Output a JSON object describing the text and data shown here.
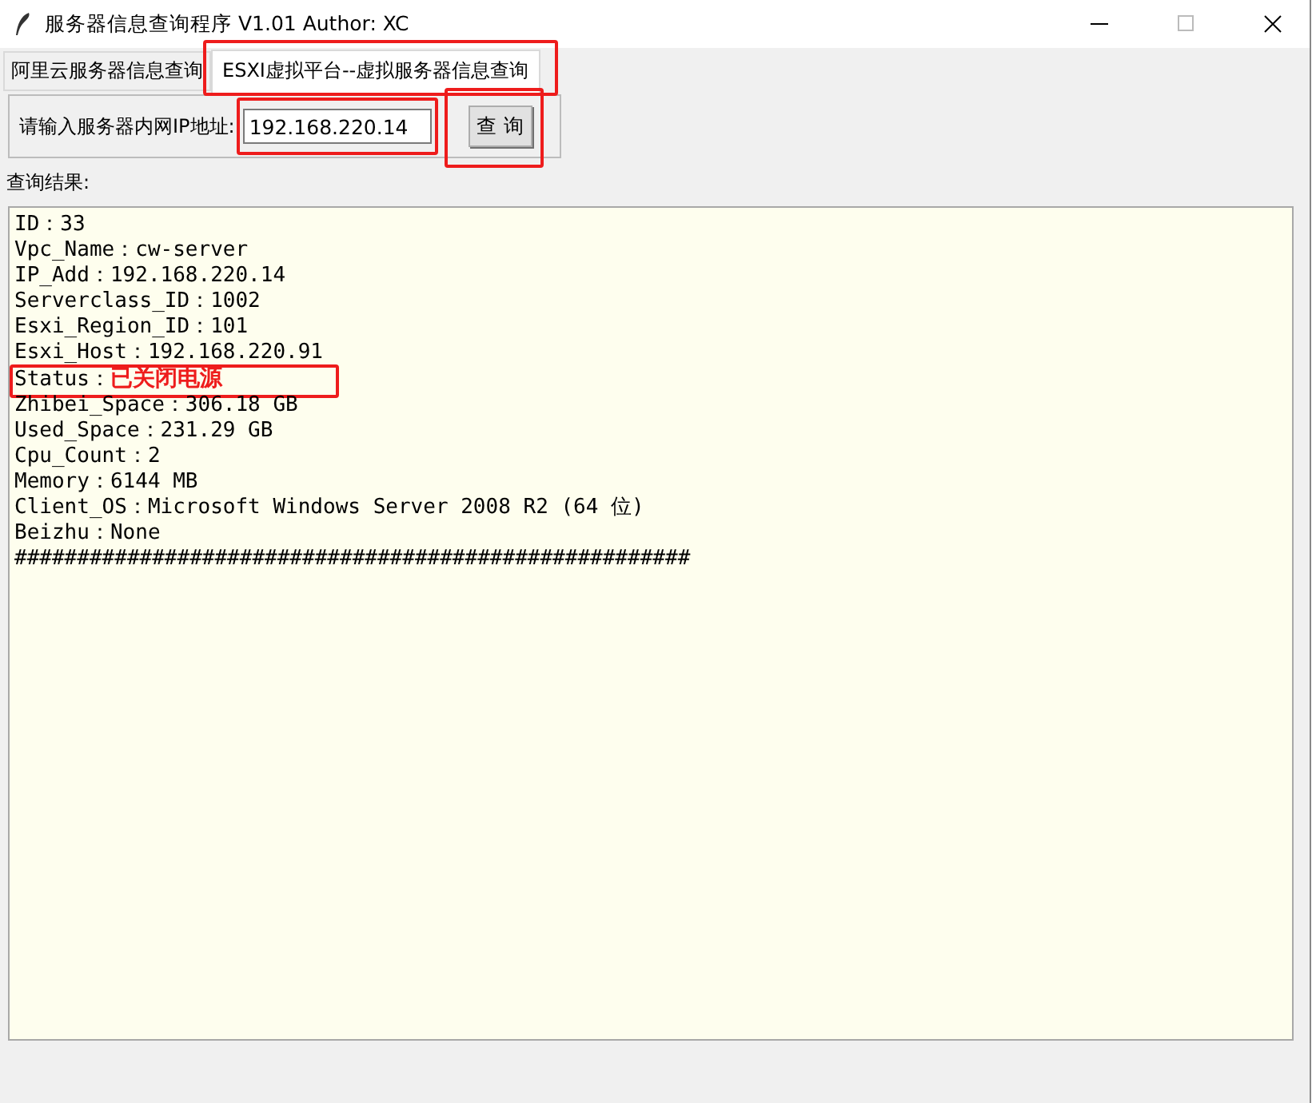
{
  "window": {
    "title": "服务器信息查询程序 V1.01 Author: XC"
  },
  "tabs": [
    {
      "label": "阿里云服务器信息查询",
      "selected": false,
      "highlighted": false
    },
    {
      "label": "ESXI虚拟平台--虚拟服务器信息查询",
      "selected": true,
      "highlighted": true
    }
  ],
  "query": {
    "label": "请输入服务器内网IP地址:",
    "ip_value": "192.168.220.14",
    "ip_highlighted": true,
    "button": "查 询",
    "button_highlighted": true
  },
  "results": {
    "label": "查询结果:",
    "lines": [
      {
        "kind": "plain",
        "text": "ID：33"
      },
      {
        "kind": "plain",
        "text": "Vpc_Name：cw-server"
      },
      {
        "kind": "plain",
        "text": "IP_Add：192.168.220.14"
      },
      {
        "kind": "plain",
        "text": "Serverclass_ID：1002"
      },
      {
        "kind": "plain",
        "text": "Esxi_Region_ID：101"
      },
      {
        "kind": "plain",
        "text": "Esxi_Host：192.168.220.91"
      },
      {
        "kind": "alert",
        "text": "Status：",
        "value": "已关闭电源",
        "highlighted": true
      },
      {
        "kind": "plain",
        "text": "Zhibei_Space：306.18 GB"
      },
      {
        "kind": "plain",
        "text": "Used_Space：231.29 GB"
      },
      {
        "kind": "plain",
        "text": "Cpu_Count：2"
      },
      {
        "kind": "plain",
        "text": "Memory：6144 MB"
      },
      {
        "kind": "plain",
        "text": "Client_OS：Microsoft Windows Server 2008 R2 (64 位)"
      },
      {
        "kind": "plain",
        "text": "Beizhu：None"
      },
      {
        "kind": "plain",
        "text": "######################################################"
      }
    ]
  }
}
